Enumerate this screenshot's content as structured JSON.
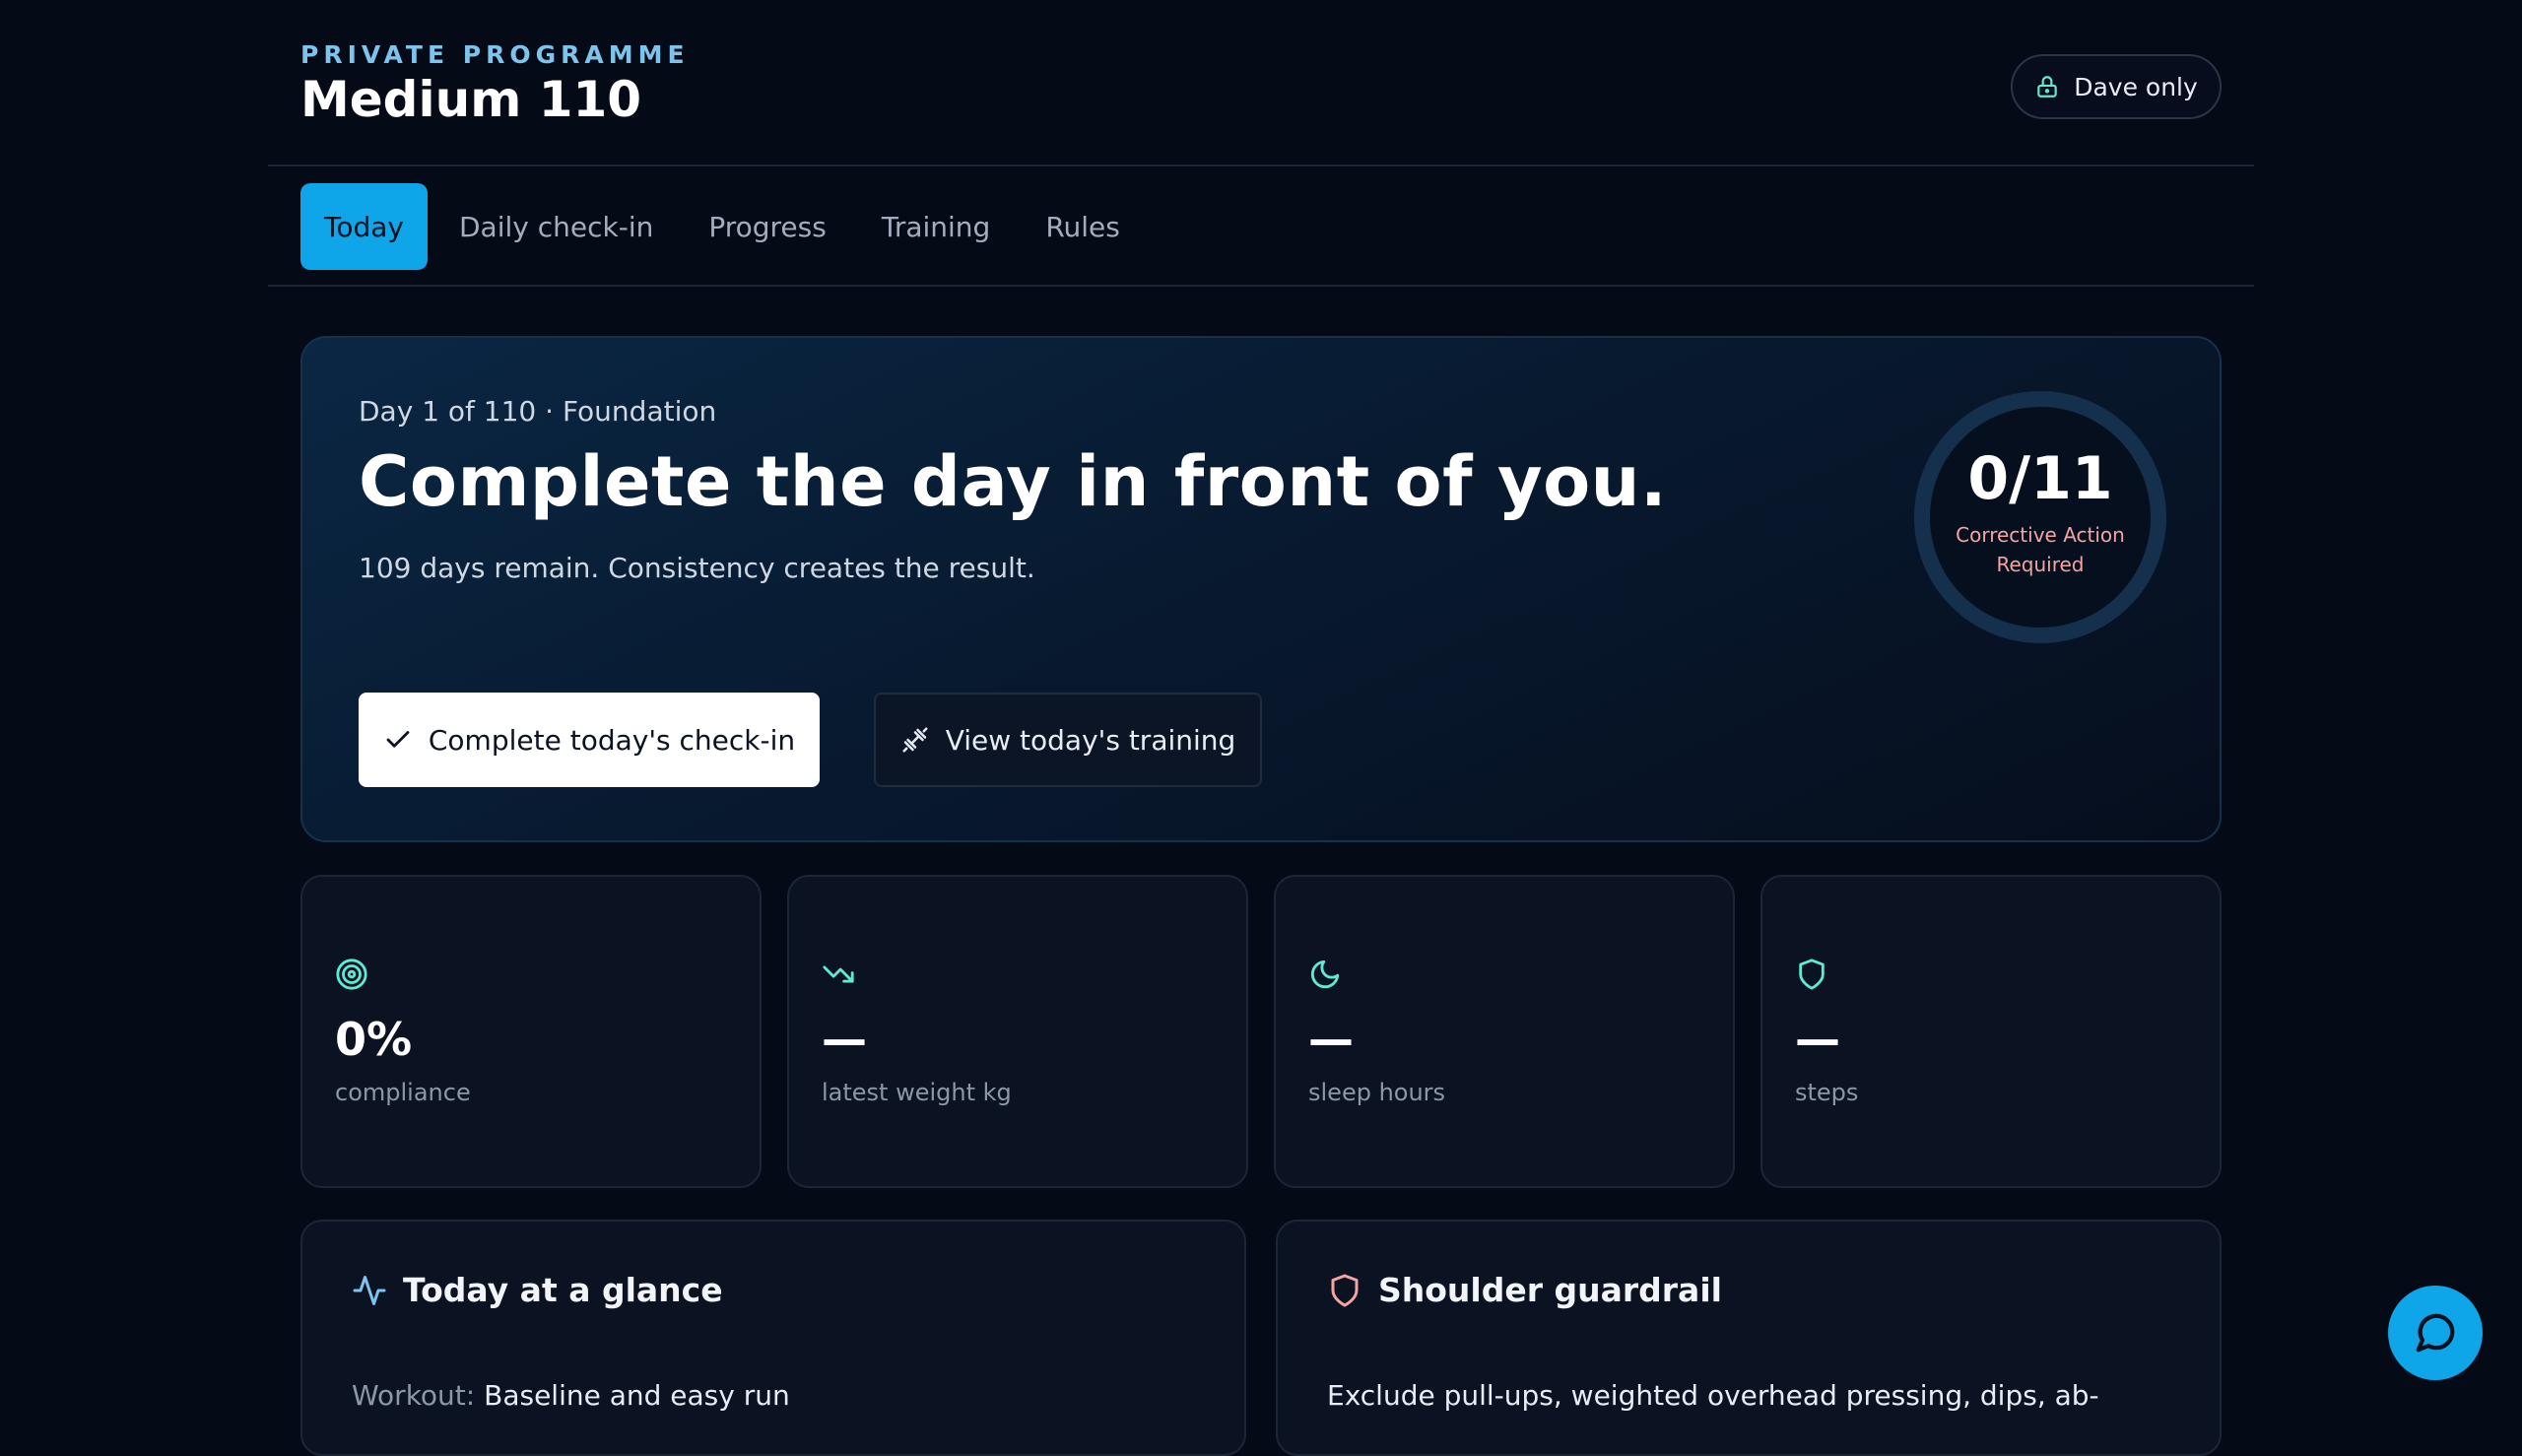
{
  "header": {
    "eyebrow": "PRIVATE PROGRAMME",
    "title": "Medium 110",
    "access_label": "Dave only"
  },
  "tabs": [
    {
      "label": "Today",
      "active": true
    },
    {
      "label": "Daily check-in",
      "active": false
    },
    {
      "label": "Progress",
      "active": false
    },
    {
      "label": "Training",
      "active": false
    },
    {
      "label": "Rules",
      "active": false
    }
  ],
  "hero": {
    "subtitle": "Day 1 of 110 · Foundation",
    "headline": "Complete the day in front of you.",
    "description": "109 days remain. Consistency creates the result.",
    "primary_button": "Complete today's check-in",
    "secondary_button": "View today's training",
    "score": "0/11",
    "score_status": "Corrective Action Required"
  },
  "stats": [
    {
      "icon": "target-icon",
      "value": "0%",
      "label": "compliance"
    },
    {
      "icon": "trending-down-icon",
      "value": "—",
      "label": "latest weight kg"
    },
    {
      "icon": "moon-icon",
      "value": "—",
      "label": "sleep hours"
    },
    {
      "icon": "shield-icon",
      "value": "—",
      "label": "steps"
    }
  ],
  "panels": {
    "glance": {
      "title": "Today at a glance",
      "workout_label": "Workout:",
      "workout_value": "Baseline and easy run"
    },
    "shoulder": {
      "title": "Shoulder guardrail",
      "text": "Exclude pull-ups, weighted overhead pressing, dips, ab-"
    }
  },
  "colors": {
    "accent": "#0ea5e9",
    "icon_teal": "#5eead4",
    "warning_text": "#f5a3a3",
    "background": "#050a17"
  }
}
